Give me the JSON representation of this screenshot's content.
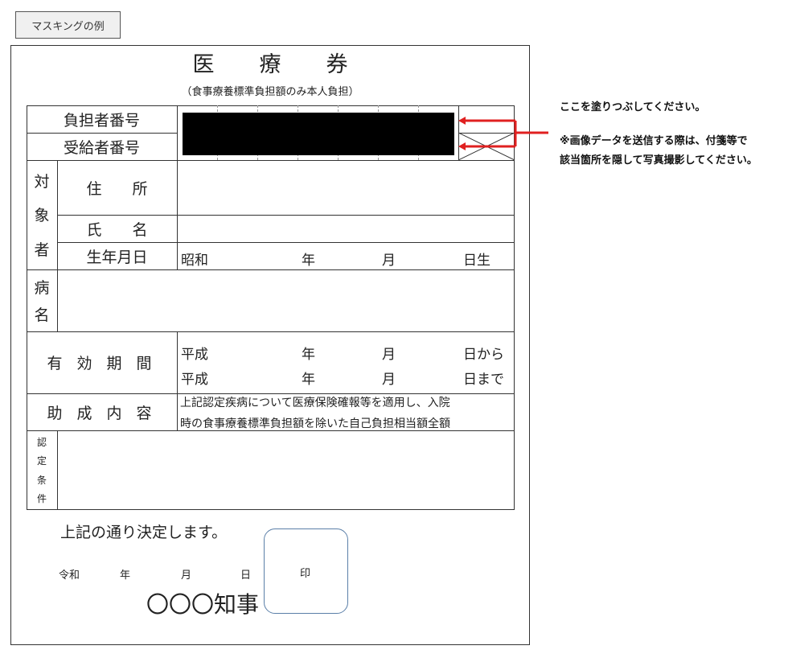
{
  "mask_button_label": "マスキングの例",
  "form": {
    "title": "医療券",
    "subtitle": "（食事療養標準負担額のみ本人負担）",
    "burden_number_label": "負担者番号",
    "recipient_number_label": "受給者番号",
    "subject_label": [
      "対",
      "象",
      "者"
    ],
    "address_label": "住　　所",
    "name_label": "氏　　名",
    "birthdate_label": "生年月日",
    "birth_era": "昭和",
    "year_unit": "年",
    "month_unit": "月",
    "birth_day_unit": "日生",
    "disease_label": [
      "病",
      "名"
    ],
    "validity_label": "有 効 期 間",
    "valid_from_era": "平成",
    "valid_from_day": "日から",
    "valid_to_era": "平成",
    "valid_to_day": "日まで",
    "subsidy_label": "助 成 内 容",
    "subsidy_line1": "上記認定疾病について医療保険確報等を適用し、入院",
    "subsidy_line2": "時の食事療養標準負担額を除いた自己負担相当額全額",
    "condition_label": [
      "認",
      "定",
      "条",
      "件"
    ],
    "decision_text": "上記の通り決定します。",
    "date_era": "令和",
    "date_year": "年",
    "date_month": "月",
    "date_day": "日",
    "seal_mark": "印",
    "governor": "〇〇〇知事"
  },
  "notes": {
    "fill_instruction": "ここを塗りつぶしてください。",
    "photo_line1": "※画像データを送信する際は、付箋等で",
    "photo_line2": "該当箇所を隠して写真撮影してください。"
  },
  "colors": {
    "arrow": "#e02020",
    "mask": "#000000",
    "seal_border": "#5a7fa8"
  }
}
